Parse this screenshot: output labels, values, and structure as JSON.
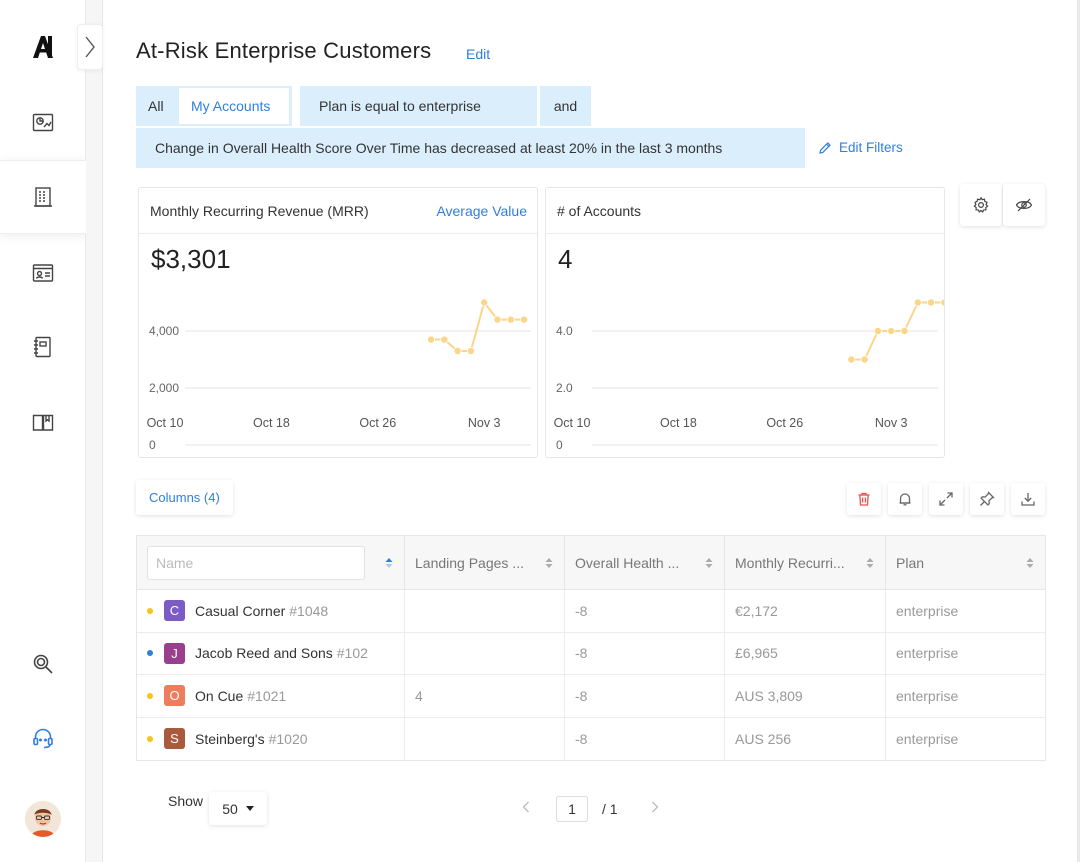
{
  "sidebar": {
    "items": [
      {
        "icon": "dashboard-chart-icon"
      },
      {
        "icon": "building-icon",
        "active": true
      },
      {
        "icon": "contact-card-icon"
      },
      {
        "icon": "notebook-icon"
      },
      {
        "icon": "book-icon"
      }
    ],
    "bottom": [
      {
        "icon": "search-icon"
      },
      {
        "icon": "support-headset-icon"
      }
    ]
  },
  "page": {
    "title": "At-Risk Enterprise Customers",
    "edit_label": "Edit"
  },
  "filters": {
    "scope_all": "All",
    "scope_mine": "My Accounts",
    "plan_filter": "Plan is equal to enterprise",
    "conjunction": "and",
    "health_filter": "Change in Overall Health Score Over Time has decreased at least 20% in the last 3 months",
    "edit_filters": "Edit Filters"
  },
  "cards": {
    "mrr": {
      "title": "Monthly Recurring Revenue (MRR)",
      "link": "Average Value",
      "value": "$3,301"
    },
    "accounts": {
      "title": "# of Accounts",
      "value": "4"
    }
  },
  "chart_data": [
    {
      "type": "line",
      "title": "Monthly Recurring Revenue (MRR)",
      "x_ticks": [
        "Oct 10",
        "Oct 18",
        "Oct 26",
        "Nov 3"
      ],
      "y_ticks": [
        "0",
        "2,000",
        "4,000"
      ],
      "ylim": [
        0,
        6000
      ],
      "grid": true,
      "color": "#fbd58a",
      "x": [
        "Oct 30",
        "Oct 31",
        "Nov 1",
        "Nov 2",
        "Nov 3",
        "Nov 4",
        "Nov 5",
        "Nov 6"
      ],
      "values": [
        3700,
        3700,
        3300,
        3300,
        5000,
        4400,
        4400,
        4400
      ]
    },
    {
      "type": "line",
      "title": "# of Accounts",
      "x_ticks": [
        "Oct 10",
        "Oct 18",
        "Oct 26",
        "Nov 3"
      ],
      "y_ticks": [
        "0",
        "2.0",
        "4.0"
      ],
      "ylim": [
        0,
        6
      ],
      "grid": true,
      "color": "#fbd58a",
      "x": [
        "Oct 31",
        "Nov 1",
        "Nov 2",
        "Nov 3",
        "Nov 4",
        "Nov 5",
        "Nov 6",
        "Nov 7"
      ],
      "values": [
        3,
        3,
        4,
        4,
        4,
        5,
        5,
        5
      ]
    }
  ],
  "table": {
    "columns_button": "Columns (4)",
    "name_placeholder": "Name",
    "headers": [
      "Landing Pages ...",
      "Overall Health ...",
      "Monthly Recurri...",
      "Plan"
    ],
    "rows": [
      {
        "dot": "#f5c518",
        "badge": "C",
        "badge_color": "#7b5cc4",
        "name": "Casual Corner",
        "id": "#1048",
        "landing": "",
        "health": "-8",
        "mrr": "€2,172",
        "plan": "enterprise"
      },
      {
        "dot": "#2f7fe0",
        "badge": "J",
        "badge_color": "#9a3f8e",
        "name": "Jacob Reed and Sons",
        "id": "#102",
        "landing": "",
        "health": "-8",
        "mrr": "£6,965",
        "plan": "enterprise"
      },
      {
        "dot": "#f5c518",
        "badge": "O",
        "badge_color": "#ee7d5e",
        "name": "On Cue",
        "id": "#1021",
        "landing": "4",
        "health": "-8",
        "mrr": "AUS 3,809",
        "plan": "enterprise"
      },
      {
        "dot": "#f5c518",
        "badge": "S",
        "badge_color": "#a85a3c",
        "name": "Steinberg's",
        "id": "#1020",
        "landing": "",
        "health": "-8",
        "mrr": "AUS 256",
        "plan": "enterprise"
      }
    ]
  },
  "pagination": {
    "show_label": "Show",
    "page_size": "50",
    "current_page": "1",
    "total_pages": "/ 1"
  },
  "colors": {
    "accent": "#2f7fe0",
    "filter_chip": "#dbeefc",
    "chart_line": "#fbd58a",
    "danger": "#e8504a"
  }
}
